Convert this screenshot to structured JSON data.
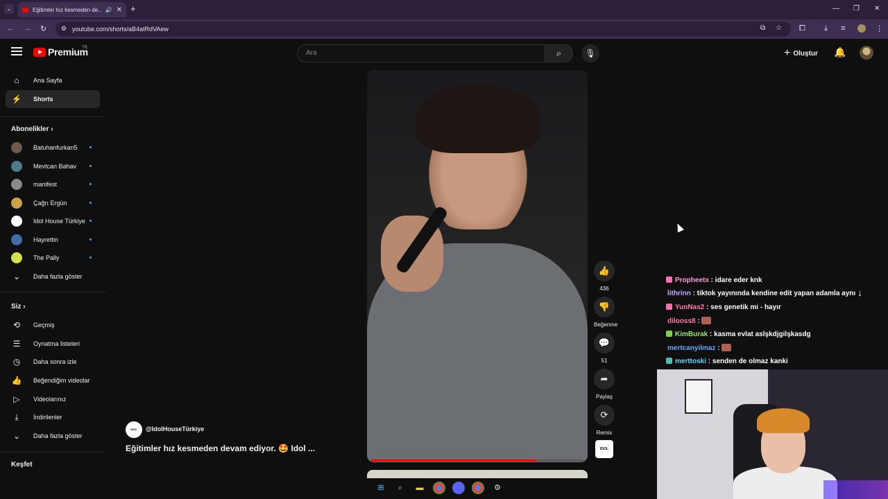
{
  "browser": {
    "tab_title": "Eğitimler hız kesmeden de…",
    "tab_audio_icon": "speaker-icon",
    "url": "youtube.com/shorts/aB4atRdVAew"
  },
  "header": {
    "logo_text": "Premium",
    "logo_region": "TR",
    "search_placeholder": "Ara",
    "create_label": "Oluştur"
  },
  "sidebar": {
    "main": [
      {
        "label": "Ana Sayfa",
        "icon": "home-icon"
      },
      {
        "label": "Shorts",
        "icon": "shorts-icon"
      }
    ],
    "subscriptions_heading": "Abonelikler",
    "subscriptions": [
      {
        "label": "Batuhanfurkan5",
        "color": "#6d5a4a"
      },
      {
        "label": "Mevtcan Bahav",
        "color": "#4f7a8a"
      },
      {
        "label": "manifest",
        "color": "#8a8a8a"
      },
      {
        "label": "Çağrı Ergün",
        "color": "#c9a24a"
      },
      {
        "label": "Idol House Türkiye",
        "color": "#ffffff"
      },
      {
        "label": "Hayrettin",
        "color": "#3f6ea8"
      },
      {
        "label": "The Pally",
        "color": "#d4e04a"
      }
    ],
    "subs_more": "Daha fazla göster",
    "you_heading": "Siz",
    "you_items": [
      {
        "label": "Geçmiş",
        "icon": "history-icon"
      },
      {
        "label": "Oynatma listeleri",
        "icon": "playlist-icon"
      },
      {
        "label": "Daha sonra izle",
        "icon": "clock-icon"
      },
      {
        "label": "Beğendiğim videolar",
        "icon": "thumbs-up-icon"
      },
      {
        "label": "Videolarınız",
        "icon": "video-icon"
      },
      {
        "label": "İndirilenler",
        "icon": "download-icon"
      }
    ],
    "you_more": "Daha fazla göster",
    "explore_heading": "Keşfet"
  },
  "short": {
    "channel_handle": "@IdolHouseTürkiye",
    "title": "Eğitimler hız kesmeden devam ediyor. 🤩 Idol ...",
    "progress": 0.78,
    "actions": {
      "like_count": "436",
      "dislike_label": "Beğenme",
      "comment_count": "51",
      "share_label": "Paylaş",
      "remix_label": "Remix"
    }
  },
  "chat": [
    {
      "user": "Propheetx",
      "msg": " : idare eder knk",
      "color": "#ff9ad0",
      "badge": "#ff6fae"
    },
    {
      "user": "lithrinn",
      "msg": " : tiktok yayınında kendine edit yapan adamla aynı",
      "color": "#c9a8ff",
      "badge": ""
    },
    {
      "user": "YunNas2",
      "msg": " : ses genetik mi - hayır",
      "color": "#ff7ab0",
      "badge": "#ff6fae"
    },
    {
      "user": "dilooss8",
      "msg": " : ",
      "color": "#ff7aa8",
      "badge": "",
      "emote": true
    },
    {
      "user": "KimBurak",
      "msg": " : kasma evlat aslşkdjgilşkasdg",
      "color": "#9be66a",
      "badge": "#7bd14a"
    },
    {
      "user": "mertcanyilmaz",
      "msg": " : ",
      "color": "#6aa8ff",
      "badge": "",
      "emote": true
    },
    {
      "user": "merttoski",
      "msg": " : senden de olmaz kanki",
      "color": "#6ad0ff",
      "badge": "#4ac0b0"
    }
  ]
}
